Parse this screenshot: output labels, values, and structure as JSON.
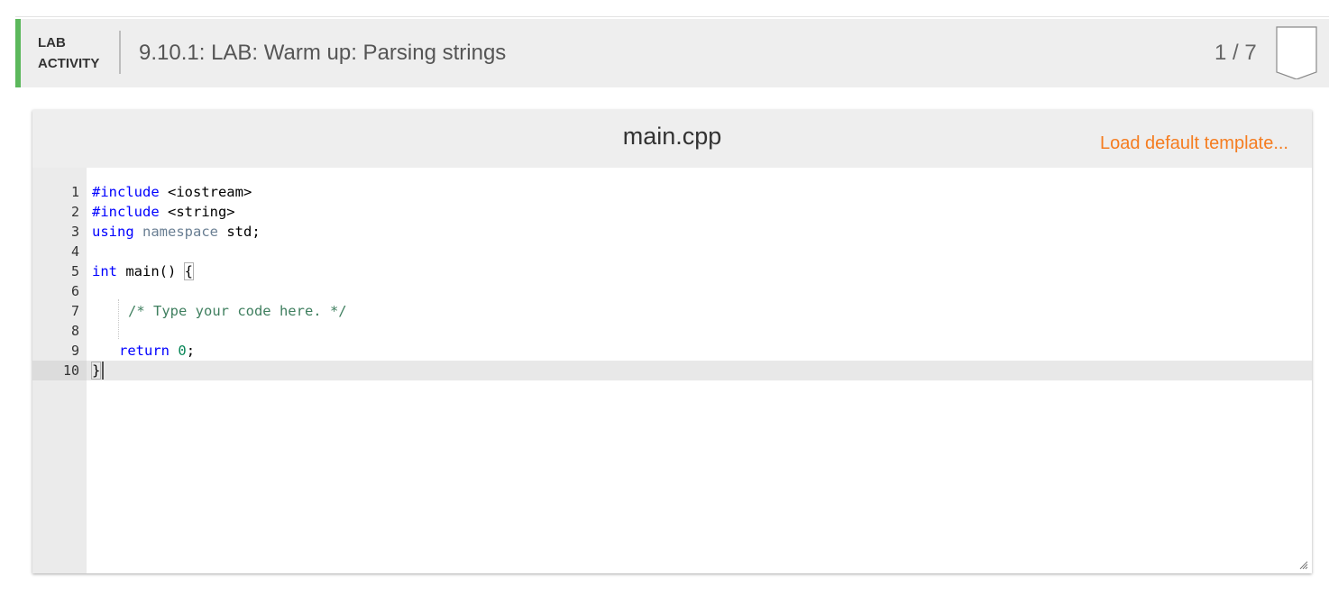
{
  "header": {
    "activity_type_line1": "LAB",
    "activity_type_line2": "ACTIVITY",
    "title": "9.10.1: LAB: Warm up: Parsing strings",
    "progress": "1 / 7",
    "accent_color": "#5cb85c"
  },
  "editor": {
    "filename": "main.cpp",
    "load_template_label": "Load default template...",
    "load_template_color": "#f57c1f",
    "line_numbers": [
      "1",
      "2",
      "3",
      "4",
      "5",
      "6",
      "7",
      "8",
      "9",
      "10"
    ],
    "active_line": "10",
    "code": {
      "l1_kw": "#include",
      "l1_rest": " <iostream>",
      "l2_kw": "#include",
      "l2_rest": " <string>",
      "l3_kw": "using",
      "l3_ns": " namespace",
      "l3_rest": " std;",
      "l5_kw": "int",
      "l5_rest": " main() ",
      "l5_brace": "{",
      "l7_comment": "/* Type your code here. */",
      "l9_kw": "return",
      "l9_num": "0",
      "l9_rest": ";",
      "l10_brace": "}"
    }
  },
  "icons": {
    "bookmark": "bookmark-icon",
    "resize": "resize-grip-icon"
  }
}
